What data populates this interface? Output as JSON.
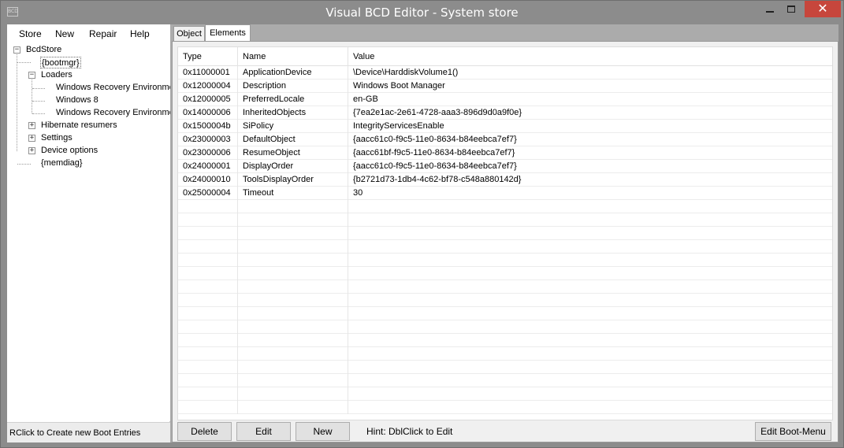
{
  "window": {
    "title": "Visual BCD Editor - System store",
    "app_icon_text": "BCD",
    "close_glyph": "✕"
  },
  "menu": {
    "items": [
      "Store",
      "New",
      "Repair",
      "Help"
    ]
  },
  "tree": {
    "root": "BcdStore",
    "bootmgr": "{bootmgr}",
    "loaders": "Loaders",
    "loader_children": [
      "Windows Recovery Environme",
      "Windows 8",
      "Windows Recovery Environme"
    ],
    "hibernate": "Hibernate resumers",
    "settings": "Settings",
    "device_options": "Device options",
    "memdiag": "{memdiag}",
    "expander_expanded": "−",
    "expander_collapsed": "+"
  },
  "status": {
    "text": "RClick to Create new Boot Entries"
  },
  "tabs": [
    {
      "label": "Object",
      "active": false
    },
    {
      "label": "Elements",
      "active": true
    }
  ],
  "elements_table": {
    "columns": [
      "Type",
      "Name",
      "Value"
    ],
    "rows": [
      [
        "0x11000001",
        "ApplicationDevice",
        "\\Device\\HarddiskVolume1()"
      ],
      [
        "0x12000004",
        "Description",
        "Windows Boot Manager"
      ],
      [
        "0x12000005",
        "PreferredLocale",
        "en-GB"
      ],
      [
        "0x14000006",
        "InheritedObjects",
        "{7ea2e1ac-2e61-4728-aaa3-896d9d0a9f0e}"
      ],
      [
        "0x1500004b",
        "SiPolicy",
        "IntegrityServicesEnable"
      ],
      [
        "0x23000003",
        "DefaultObject",
        "{aacc61c0-f9c5-11e0-8634-b84eebca7ef7}"
      ],
      [
        "0x23000006",
        "ResumeObject",
        "{aacc61bf-f9c5-11e0-8634-b84eebca7ef7}"
      ],
      [
        "0x24000001",
        "DisplayOrder",
        "{aacc61c0-f9c5-11e0-8634-b84eebca7ef7}"
      ],
      [
        "0x24000010",
        "ToolsDisplayOrder",
        "{b2721d73-1db4-4c62-bf78-c548a880142d}"
      ],
      [
        "0x25000004",
        "Timeout",
        "30"
      ]
    ]
  },
  "buttons": {
    "delete": "Delete",
    "edit": "Edit",
    "new": "New",
    "edit_boot_menu": "Edit Boot-Menu"
  },
  "hint": "Hint: DblClick to Edit",
  "colors": {
    "titlebar": "#8c8c8c",
    "close_button": "#c7463c"
  }
}
